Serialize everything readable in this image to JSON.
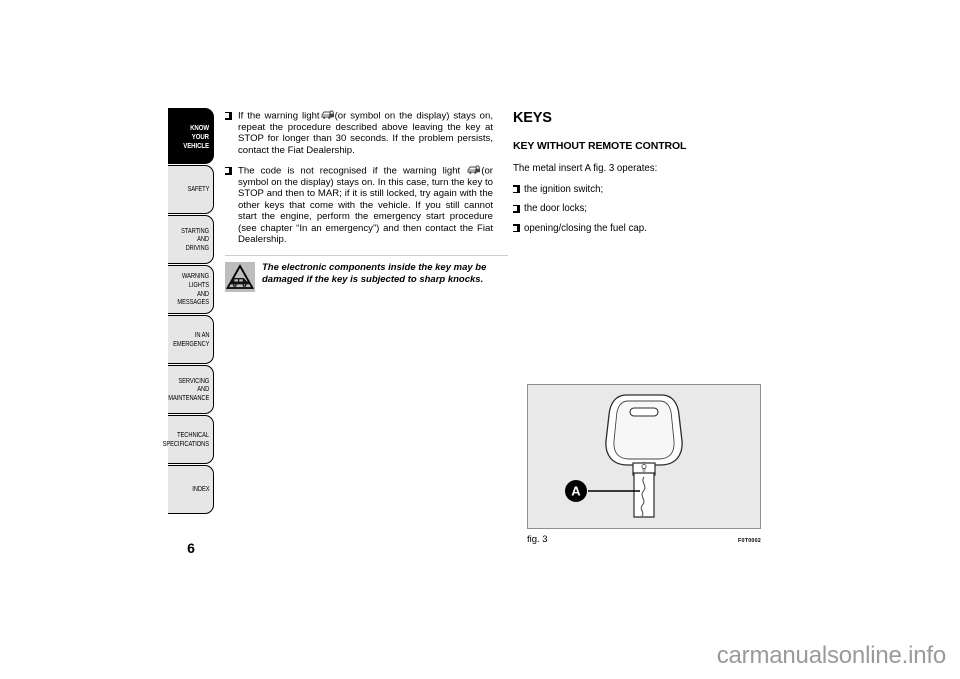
{
  "document": {
    "page_number": "6",
    "watermark": "carmanualsonline.info"
  },
  "sidebar": {
    "items": [
      {
        "label": "KNOW YOUR\nVEHICLE",
        "active": true,
        "name": "know-your-vehicle"
      },
      {
        "label": "SAFETY",
        "active": false,
        "name": "safety"
      },
      {
        "label": "STARTING AND\nDRIVING",
        "active": false,
        "name": "starting-and-driving"
      },
      {
        "label": "WARNING LIGHTS\nAND MESSAGES",
        "active": false,
        "name": "warning-lights-and-messages"
      },
      {
        "label": "IN AN EMERGENCY",
        "active": false,
        "name": "in-an-emergency"
      },
      {
        "label": "SERVICING AND\nMAINTENANCE",
        "active": false,
        "name": "servicing-and-maintenance"
      },
      {
        "label": "TECHNICAL\nSPECIFICATIONS",
        "active": false,
        "name": "technical-specifications"
      },
      {
        "label": "INDEX",
        "active": false,
        "name": "index"
      }
    ]
  },
  "left_column": {
    "paragraph_1_before_icon": "If the warning light",
    "paragraph_1_after_icon": "(or symbol on the display) stays on, repeat the procedure described above leaving the key at STOP for longer than 30 seconds. If the problem persists, contact the Fiat Dealership.",
    "paragraph_2_before_icon": "The code is not recognised if the warning light",
    "paragraph_2_after_icon": "(or symbol on the display) stays on. In this case, turn the key to STOP and then to MAR; if it is still locked, try again with the other keys that come with the vehicle. If you still cannot start the engine, perform the emergency start procedure (see chapter “In an emergency”) and then contact the Fiat Dealership.",
    "warning_text": "The electronic components inside the key may be damaged if the key is subjected to sharp knocks.",
    "icons": {
      "immobiliser": "car-lock-immobiliser-icon",
      "warning": "warning-triangle-vehicle-icon"
    }
  },
  "right_column": {
    "title": "KEYS",
    "subtitle": "KEY WITHOUT REMOTE CONTROL",
    "intro": "The metal insert A fig. 3 operates:",
    "bullets": [
      "the ignition switch;",
      "the door locks;",
      "opening/closing the fuel cap."
    ]
  },
  "figure": {
    "caption": "fig. 3",
    "code": "F0T0002",
    "callout_label": "A",
    "subject": "car-key-illustration"
  },
  "colors": {
    "active_tab_bg": "#000000",
    "tab_bg": "#e6e6e6",
    "figure_bg": "#e9e9e9",
    "figure_border": "#8f8f8f",
    "rule": "#cfcfcf",
    "warning_icon_bg": "#bdbdbd",
    "watermark": "#9a9a9a"
  }
}
